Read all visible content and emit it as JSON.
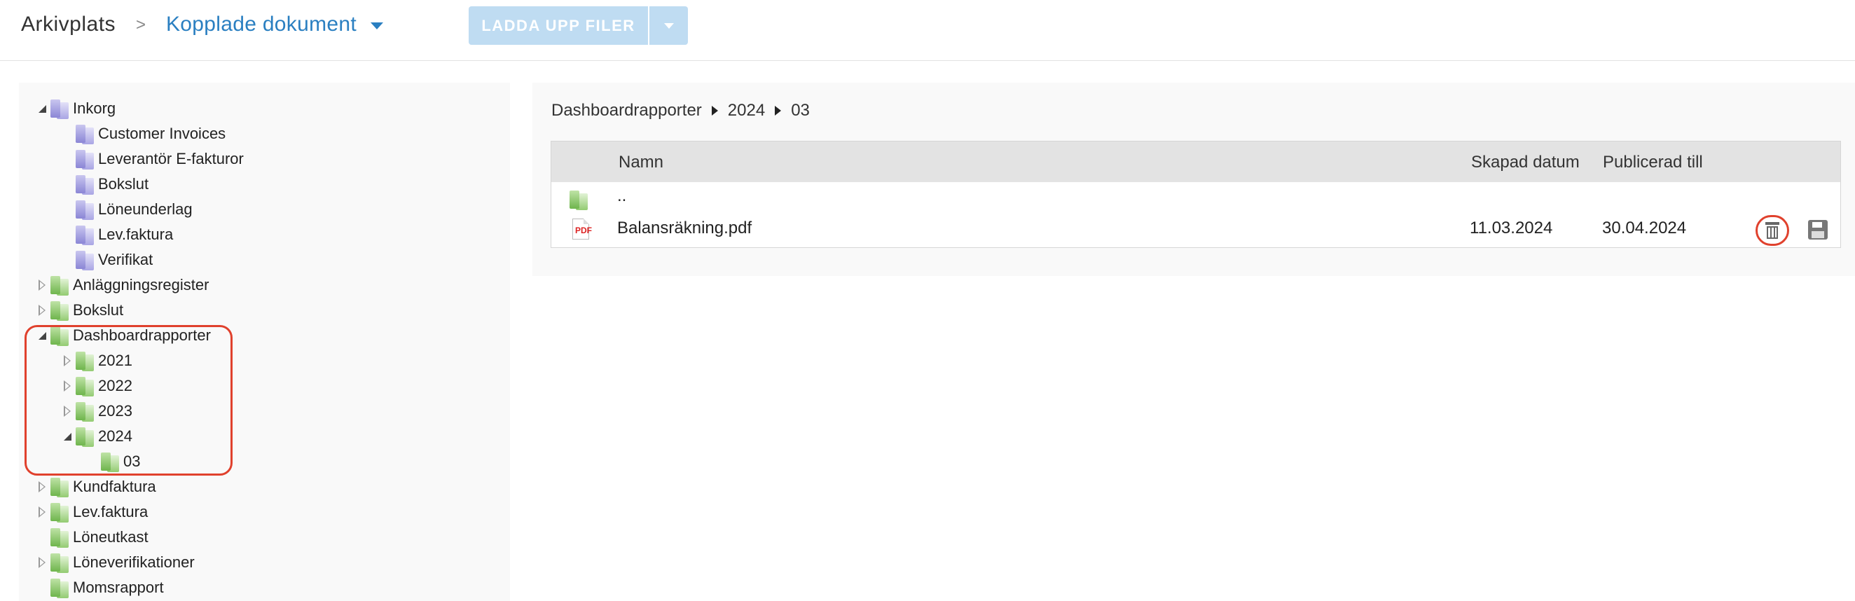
{
  "header": {
    "root_crumb": "Arkivplats",
    "separator": ">",
    "current_crumb": "Kopplade dokument",
    "upload_label": "LADDA UPP FILER"
  },
  "tree": {
    "inkorg": "Inkorg",
    "inkorg_children": [
      "Customer Invoices",
      "Leverantör E-fakturor",
      "Bokslut",
      "Löneunderlag",
      "Lev.faktura",
      "Verifikat"
    ],
    "anlaggningsregister": "Anläggningsregister",
    "bokslut": "Bokslut",
    "dashboardrapporter": "Dashboardrapporter",
    "years": [
      "2021",
      "2022",
      "2023",
      "2024"
    ],
    "month_2024": "03",
    "kundfaktura": "Kundfaktura",
    "levfaktura": "Lev.faktura",
    "loneutkast": "Löneutkast",
    "loneverifikationer": "Löneverifikationer",
    "momsrapport": "Momsrapport"
  },
  "path": [
    "Dashboardrapporter",
    "2024",
    "03"
  ],
  "table": {
    "columns": [
      "Namn",
      "Skapad datum",
      "Publicerad till"
    ],
    "parent_row": "..",
    "rows": [
      {
        "name": "Balansräkning.pdf",
        "created": "11.03.2024",
        "published": "30.04.2024"
      }
    ]
  }
}
